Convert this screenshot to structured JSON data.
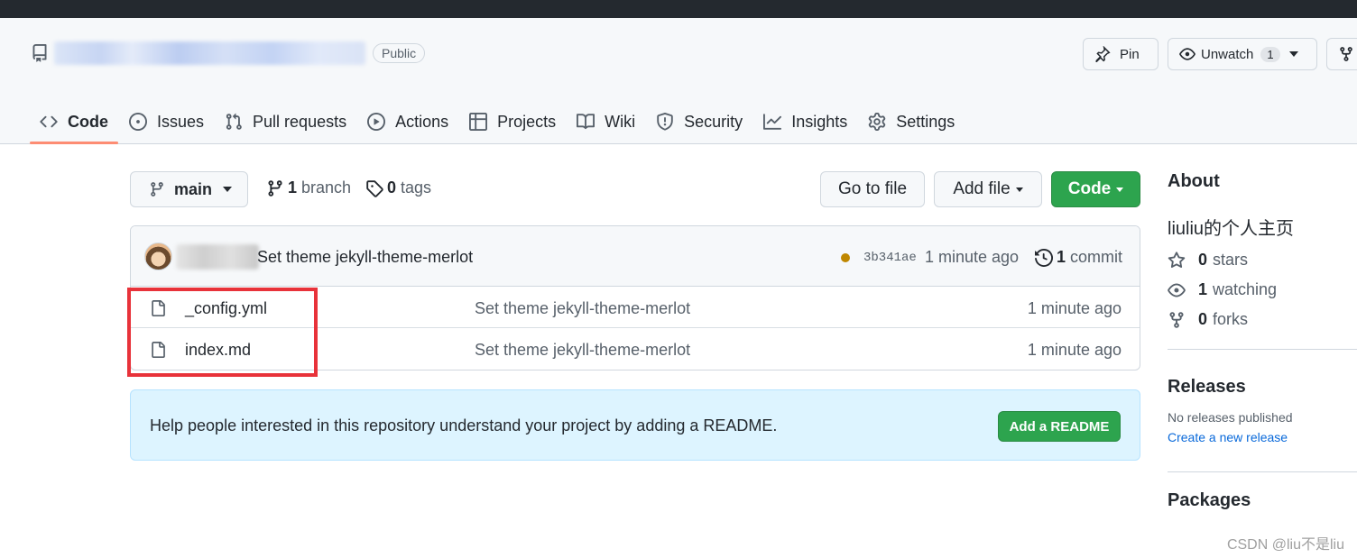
{
  "header": {
    "visibility_badge": "Public",
    "pin_label": "Pin",
    "watch_label": "Unwatch",
    "watch_count": "1"
  },
  "nav": {
    "tabs": [
      {
        "label": "Code",
        "icon": "code-icon"
      },
      {
        "label": "Issues",
        "icon": "issue-icon"
      },
      {
        "label": "Pull requests",
        "icon": "pull-request-icon"
      },
      {
        "label": "Actions",
        "icon": "play-icon"
      },
      {
        "label": "Projects",
        "icon": "table-icon"
      },
      {
        "label": "Wiki",
        "icon": "book-icon"
      },
      {
        "label": "Security",
        "icon": "shield-icon"
      },
      {
        "label": "Insights",
        "icon": "graph-icon"
      },
      {
        "label": "Settings",
        "icon": "gear-icon"
      }
    ]
  },
  "toolbar": {
    "branch": "main",
    "branch_count": "1",
    "branch_word": "branch",
    "tag_count": "0",
    "tag_word": "tags",
    "goto_file": "Go to file",
    "add_file": "Add file",
    "code": "Code"
  },
  "latest_commit": {
    "message": "Set theme jekyll-theme-merlot",
    "sha": "3b341ae",
    "time": "1 minute ago",
    "count": "1",
    "count_word": "commit",
    "status_color": "#bf8700"
  },
  "files": [
    {
      "name": "_config.yml",
      "message": "Set theme jekyll-theme-merlot",
      "time": "1 minute ago"
    },
    {
      "name": "index.md",
      "message": "Set theme jekyll-theme-merlot",
      "time": "1 minute ago"
    }
  ],
  "readme_banner": {
    "text": "Help people interested in this repository understand your project by adding a README.",
    "button": "Add a README"
  },
  "sidebar": {
    "about_heading": "About",
    "description": "liuliu的个人主页",
    "stars_count": "0",
    "stars_word": "stars",
    "watching_count": "1",
    "watching_word": "watching",
    "forks_count": "0",
    "forks_word": "forks",
    "releases_heading": "Releases",
    "no_releases": "No releases published",
    "create_release": "Create a new release",
    "packages_heading": "Packages"
  },
  "colors": {
    "primary_green": "#2da44e",
    "selected_tab_underline": "#fd8c73",
    "annotation_red": "#e8323a",
    "link_blue": "#0969da"
  },
  "watermark": "CSDN @liu不是liu"
}
